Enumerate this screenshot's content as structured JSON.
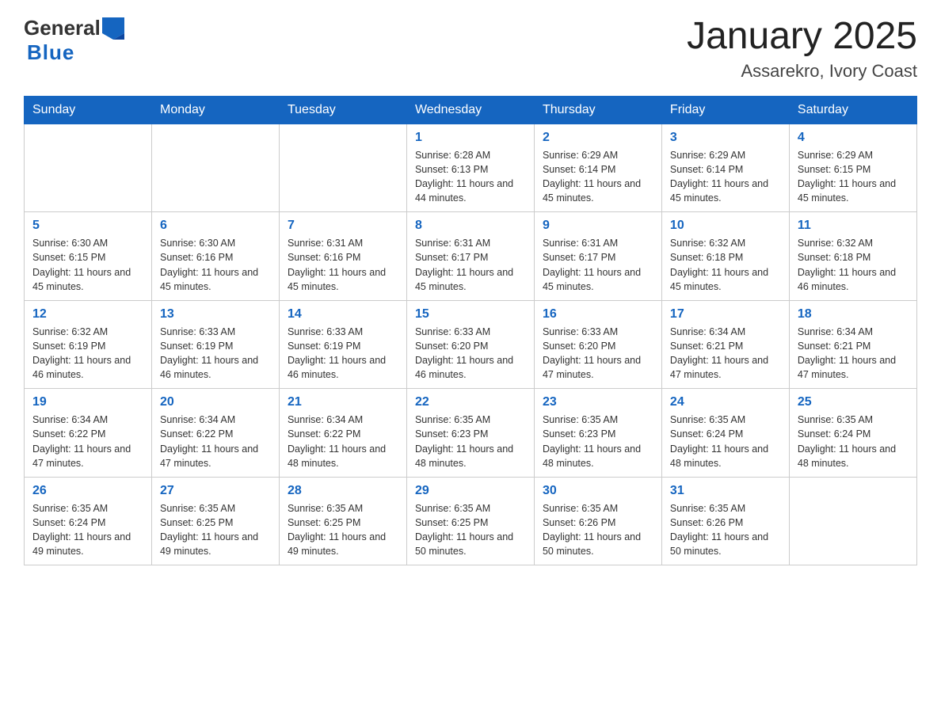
{
  "header": {
    "logo_general": "General",
    "logo_blue": "Blue",
    "month_title": "January 2025",
    "location": "Assarekro, Ivory Coast"
  },
  "weekdays": [
    "Sunday",
    "Monday",
    "Tuesday",
    "Wednesday",
    "Thursday",
    "Friday",
    "Saturday"
  ],
  "weeks": [
    [
      {
        "day": "",
        "info": ""
      },
      {
        "day": "",
        "info": ""
      },
      {
        "day": "",
        "info": ""
      },
      {
        "day": "1",
        "info": "Sunrise: 6:28 AM\nSunset: 6:13 PM\nDaylight: 11 hours and 44 minutes."
      },
      {
        "day": "2",
        "info": "Sunrise: 6:29 AM\nSunset: 6:14 PM\nDaylight: 11 hours and 45 minutes."
      },
      {
        "day": "3",
        "info": "Sunrise: 6:29 AM\nSunset: 6:14 PM\nDaylight: 11 hours and 45 minutes."
      },
      {
        "day": "4",
        "info": "Sunrise: 6:29 AM\nSunset: 6:15 PM\nDaylight: 11 hours and 45 minutes."
      }
    ],
    [
      {
        "day": "5",
        "info": "Sunrise: 6:30 AM\nSunset: 6:15 PM\nDaylight: 11 hours and 45 minutes."
      },
      {
        "day": "6",
        "info": "Sunrise: 6:30 AM\nSunset: 6:16 PM\nDaylight: 11 hours and 45 minutes."
      },
      {
        "day": "7",
        "info": "Sunrise: 6:31 AM\nSunset: 6:16 PM\nDaylight: 11 hours and 45 minutes."
      },
      {
        "day": "8",
        "info": "Sunrise: 6:31 AM\nSunset: 6:17 PM\nDaylight: 11 hours and 45 minutes."
      },
      {
        "day": "9",
        "info": "Sunrise: 6:31 AM\nSunset: 6:17 PM\nDaylight: 11 hours and 45 minutes."
      },
      {
        "day": "10",
        "info": "Sunrise: 6:32 AM\nSunset: 6:18 PM\nDaylight: 11 hours and 45 minutes."
      },
      {
        "day": "11",
        "info": "Sunrise: 6:32 AM\nSunset: 6:18 PM\nDaylight: 11 hours and 46 minutes."
      }
    ],
    [
      {
        "day": "12",
        "info": "Sunrise: 6:32 AM\nSunset: 6:19 PM\nDaylight: 11 hours and 46 minutes."
      },
      {
        "day": "13",
        "info": "Sunrise: 6:33 AM\nSunset: 6:19 PM\nDaylight: 11 hours and 46 minutes."
      },
      {
        "day": "14",
        "info": "Sunrise: 6:33 AM\nSunset: 6:19 PM\nDaylight: 11 hours and 46 minutes."
      },
      {
        "day": "15",
        "info": "Sunrise: 6:33 AM\nSunset: 6:20 PM\nDaylight: 11 hours and 46 minutes."
      },
      {
        "day": "16",
        "info": "Sunrise: 6:33 AM\nSunset: 6:20 PM\nDaylight: 11 hours and 47 minutes."
      },
      {
        "day": "17",
        "info": "Sunrise: 6:34 AM\nSunset: 6:21 PM\nDaylight: 11 hours and 47 minutes."
      },
      {
        "day": "18",
        "info": "Sunrise: 6:34 AM\nSunset: 6:21 PM\nDaylight: 11 hours and 47 minutes."
      }
    ],
    [
      {
        "day": "19",
        "info": "Sunrise: 6:34 AM\nSunset: 6:22 PM\nDaylight: 11 hours and 47 minutes."
      },
      {
        "day": "20",
        "info": "Sunrise: 6:34 AM\nSunset: 6:22 PM\nDaylight: 11 hours and 47 minutes."
      },
      {
        "day": "21",
        "info": "Sunrise: 6:34 AM\nSunset: 6:22 PM\nDaylight: 11 hours and 48 minutes."
      },
      {
        "day": "22",
        "info": "Sunrise: 6:35 AM\nSunset: 6:23 PM\nDaylight: 11 hours and 48 minutes."
      },
      {
        "day": "23",
        "info": "Sunrise: 6:35 AM\nSunset: 6:23 PM\nDaylight: 11 hours and 48 minutes."
      },
      {
        "day": "24",
        "info": "Sunrise: 6:35 AM\nSunset: 6:24 PM\nDaylight: 11 hours and 48 minutes."
      },
      {
        "day": "25",
        "info": "Sunrise: 6:35 AM\nSunset: 6:24 PM\nDaylight: 11 hours and 48 minutes."
      }
    ],
    [
      {
        "day": "26",
        "info": "Sunrise: 6:35 AM\nSunset: 6:24 PM\nDaylight: 11 hours and 49 minutes."
      },
      {
        "day": "27",
        "info": "Sunrise: 6:35 AM\nSunset: 6:25 PM\nDaylight: 11 hours and 49 minutes."
      },
      {
        "day": "28",
        "info": "Sunrise: 6:35 AM\nSunset: 6:25 PM\nDaylight: 11 hours and 49 minutes."
      },
      {
        "day": "29",
        "info": "Sunrise: 6:35 AM\nSunset: 6:25 PM\nDaylight: 11 hours and 50 minutes."
      },
      {
        "day": "30",
        "info": "Sunrise: 6:35 AM\nSunset: 6:26 PM\nDaylight: 11 hours and 50 minutes."
      },
      {
        "day": "31",
        "info": "Sunrise: 6:35 AM\nSunset: 6:26 PM\nDaylight: 11 hours and 50 minutes."
      },
      {
        "day": "",
        "info": ""
      }
    ]
  ]
}
